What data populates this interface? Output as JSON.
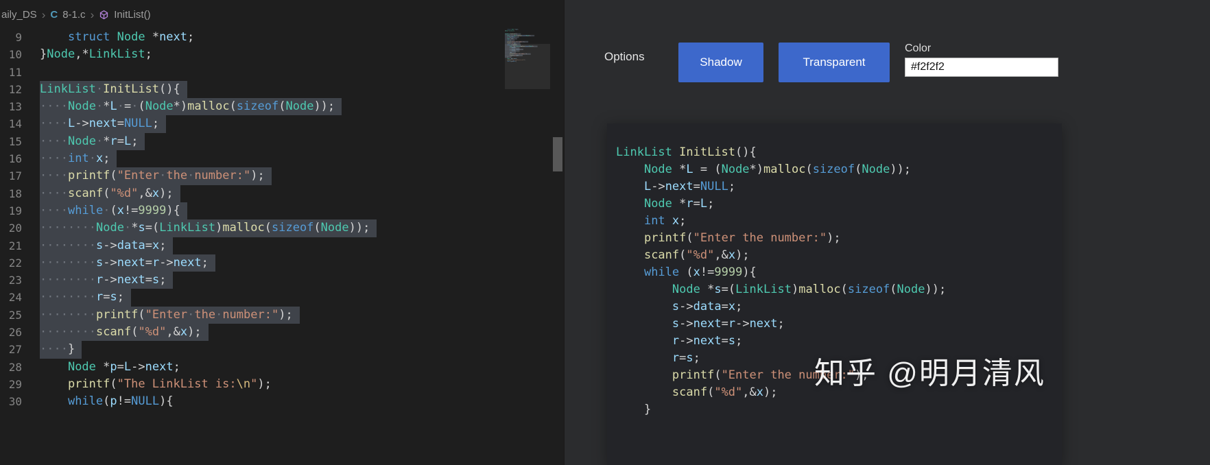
{
  "breadcrumb": {
    "items": [
      {
        "label": "aily_DS",
        "icon": null
      },
      {
        "label": "8-1.c",
        "icon": "c-file-icon"
      },
      {
        "label": "InitList()",
        "icon": "symbol-method-icon"
      }
    ]
  },
  "editor": {
    "lines": [
      {
        "num": 9,
        "sel": false,
        "tokens": [
          [
            "p",
            "    "
          ],
          [
            "k",
            "struct"
          ],
          [
            "p",
            " "
          ],
          [
            "t",
            "Node"
          ],
          [
            "p",
            " *"
          ],
          [
            "v",
            "next"
          ],
          [
            "p",
            ";"
          ]
        ]
      },
      {
        "num": 10,
        "sel": false,
        "tokens": [
          [
            "p",
            "}"
          ],
          [
            "t",
            "Node"
          ],
          [
            "p",
            ",*"
          ],
          [
            "t",
            "LinkList"
          ],
          [
            "p",
            ";"
          ]
        ]
      },
      {
        "num": 11,
        "sel": false,
        "tokens": []
      },
      {
        "num": 12,
        "sel": true,
        "tokens": [
          [
            "t",
            "LinkList"
          ],
          [
            "p",
            " "
          ],
          [
            "f",
            "InitList"
          ],
          [
            "p",
            "(){"
          ]
        ]
      },
      {
        "num": 13,
        "sel": true,
        "tokens": [
          [
            "p",
            "    "
          ],
          [
            "t",
            "Node"
          ],
          [
            "p",
            " *"
          ],
          [
            "v",
            "L"
          ],
          [
            "p",
            " = ("
          ],
          [
            "t",
            "Node"
          ],
          [
            "p",
            "*)"
          ],
          [
            "f",
            "malloc"
          ],
          [
            "p",
            "("
          ],
          [
            "k",
            "sizeof"
          ],
          [
            "p",
            "("
          ],
          [
            "t",
            "Node"
          ],
          [
            "p",
            "));"
          ]
        ]
      },
      {
        "num": 14,
        "sel": true,
        "tokens": [
          [
            "p",
            "    "
          ],
          [
            "v",
            "L"
          ],
          [
            "p",
            "->"
          ],
          [
            "v",
            "next"
          ],
          [
            "p",
            "="
          ],
          [
            "k",
            "NULL"
          ],
          [
            "p",
            ";"
          ]
        ]
      },
      {
        "num": 15,
        "sel": true,
        "tokens": [
          [
            "p",
            "    "
          ],
          [
            "t",
            "Node"
          ],
          [
            "p",
            " *"
          ],
          [
            "v",
            "r"
          ],
          [
            "p",
            "="
          ],
          [
            "v",
            "L"
          ],
          [
            "p",
            ";"
          ]
        ]
      },
      {
        "num": 16,
        "sel": true,
        "tokens": [
          [
            "p",
            "    "
          ],
          [
            "k",
            "int"
          ],
          [
            "p",
            " "
          ],
          [
            "v",
            "x"
          ],
          [
            "p",
            ";"
          ]
        ]
      },
      {
        "num": 17,
        "sel": true,
        "tokens": [
          [
            "p",
            "    "
          ],
          [
            "f",
            "printf"
          ],
          [
            "p",
            "("
          ],
          [
            "s",
            "\"Enter the number:\""
          ],
          [
            "p",
            ");"
          ]
        ]
      },
      {
        "num": 18,
        "sel": true,
        "tokens": [
          [
            "p",
            "    "
          ],
          [
            "f",
            "scanf"
          ],
          [
            "p",
            "("
          ],
          [
            "s",
            "\"%d\""
          ],
          [
            "p",
            ",&"
          ],
          [
            "v",
            "x"
          ],
          [
            "p",
            ");"
          ]
        ]
      },
      {
        "num": 19,
        "sel": true,
        "tokens": [
          [
            "p",
            "    "
          ],
          [
            "k",
            "while"
          ],
          [
            "p",
            " ("
          ],
          [
            "v",
            "x"
          ],
          [
            "p",
            "!="
          ],
          [
            "n",
            "9999"
          ],
          [
            "p",
            "){"
          ]
        ]
      },
      {
        "num": 20,
        "sel": true,
        "tokens": [
          [
            "p",
            "        "
          ],
          [
            "t",
            "Node"
          ],
          [
            "p",
            " *"
          ],
          [
            "v",
            "s"
          ],
          [
            "p",
            "=("
          ],
          [
            "t",
            "LinkList"
          ],
          [
            "p",
            ")"
          ],
          [
            "f",
            "malloc"
          ],
          [
            "p",
            "("
          ],
          [
            "k",
            "sizeof"
          ],
          [
            "p",
            "("
          ],
          [
            "t",
            "Node"
          ],
          [
            "p",
            "));"
          ]
        ]
      },
      {
        "num": 21,
        "sel": true,
        "tokens": [
          [
            "p",
            "        "
          ],
          [
            "v",
            "s"
          ],
          [
            "p",
            "->"
          ],
          [
            "v",
            "data"
          ],
          [
            "p",
            "="
          ],
          [
            "v",
            "x"
          ],
          [
            "p",
            ";"
          ]
        ]
      },
      {
        "num": 22,
        "sel": true,
        "tokens": [
          [
            "p",
            "        "
          ],
          [
            "v",
            "s"
          ],
          [
            "p",
            "->"
          ],
          [
            "v",
            "next"
          ],
          [
            "p",
            "="
          ],
          [
            "v",
            "r"
          ],
          [
            "p",
            "->"
          ],
          [
            "v",
            "next"
          ],
          [
            "p",
            ";"
          ]
        ]
      },
      {
        "num": 23,
        "sel": true,
        "tokens": [
          [
            "p",
            "        "
          ],
          [
            "v",
            "r"
          ],
          [
            "p",
            "->"
          ],
          [
            "v",
            "next"
          ],
          [
            "p",
            "="
          ],
          [
            "v",
            "s"
          ],
          [
            "p",
            ";"
          ]
        ]
      },
      {
        "num": 24,
        "sel": true,
        "tokens": [
          [
            "p",
            "        "
          ],
          [
            "v",
            "r"
          ],
          [
            "p",
            "="
          ],
          [
            "v",
            "s"
          ],
          [
            "p",
            ";"
          ]
        ]
      },
      {
        "num": 25,
        "sel": true,
        "tokens": [
          [
            "p",
            "        "
          ],
          [
            "f",
            "printf"
          ],
          [
            "p",
            "("
          ],
          [
            "s",
            "\"Enter the number:\""
          ],
          [
            "p",
            ");"
          ]
        ]
      },
      {
        "num": 26,
        "sel": true,
        "tokens": [
          [
            "p",
            "        "
          ],
          [
            "f",
            "scanf"
          ],
          [
            "p",
            "("
          ],
          [
            "s",
            "\"%d\""
          ],
          [
            "p",
            ",&"
          ],
          [
            "v",
            "x"
          ],
          [
            "p",
            ");"
          ]
        ]
      },
      {
        "num": 27,
        "sel": true,
        "tokens": [
          [
            "p",
            "    }"
          ]
        ]
      },
      {
        "num": 28,
        "sel": false,
        "tokens": [
          [
            "p",
            "    "
          ],
          [
            "t",
            "Node"
          ],
          [
            "p",
            " *"
          ],
          [
            "v",
            "p"
          ],
          [
            "p",
            "="
          ],
          [
            "v",
            "L"
          ],
          [
            "p",
            "->"
          ],
          [
            "v",
            "next"
          ],
          [
            "p",
            ";"
          ]
        ]
      },
      {
        "num": 29,
        "sel": false,
        "tokens": [
          [
            "p",
            "    "
          ],
          [
            "f",
            "printf"
          ],
          [
            "p",
            "("
          ],
          [
            "s",
            "\"The LinkList is:"
          ],
          [
            "e",
            "\\n"
          ],
          [
            "s",
            "\""
          ],
          [
            "p",
            ");"
          ]
        ]
      },
      {
        "num": 30,
        "sel": false,
        "tokens": [
          [
            "p",
            "    "
          ],
          [
            "k",
            "while"
          ],
          [
            "p",
            "("
          ],
          [
            "v",
            "p"
          ],
          [
            "p",
            "!="
          ],
          [
            "k",
            "NULL"
          ],
          [
            "p",
            "){"
          ]
        ]
      }
    ]
  },
  "preview": {
    "from_line": 12,
    "to_line": 27
  },
  "panel": {
    "options_label": "Options",
    "shadow_button": "Shadow",
    "transparent_button": "Transparent",
    "color_label": "Color",
    "color_value": "#f2f2f2",
    "watermark": "知乎 @明月清风"
  },
  "colors": {
    "editor_bg": "#1e1e1e",
    "panel_bg": "#2b2c2e",
    "card_bg": "#232428",
    "button_blue": "#3d68cb",
    "selection_bg": "#3f434a",
    "input_bg": "#ffffff",
    "syntax": {
      "keyword": "#569cd6",
      "type": "#4ec9b0",
      "function": "#dcdcaa",
      "variable": "#9cdcfe",
      "string": "#ce9178",
      "escape": "#d7ba7d",
      "number": "#b5cea8",
      "default": "#d4d4d4"
    }
  }
}
